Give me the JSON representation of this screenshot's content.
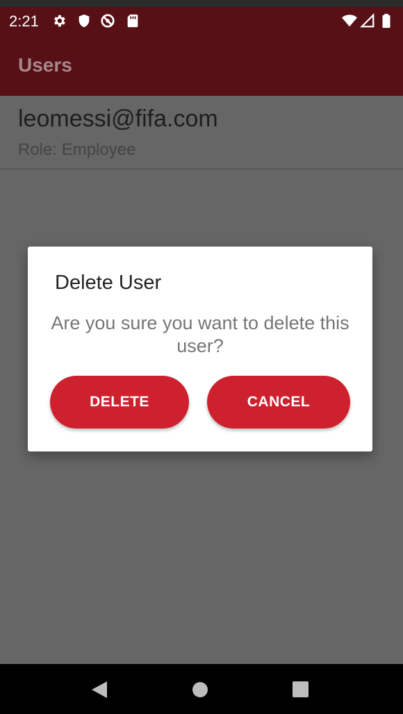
{
  "status_bar": {
    "time": "2:21",
    "left_icons": [
      "gear-icon",
      "shield-icon",
      "no-sync-icon",
      "sd-card-icon"
    ],
    "right_icons": [
      "wifi-icon",
      "cell-signal-icon",
      "battery-icon"
    ]
  },
  "app_bar": {
    "title": "Users"
  },
  "users": [
    {
      "email": "leomessi@fifa.com",
      "role": "Role: Employee"
    }
  ],
  "dialog": {
    "title": "Delete User",
    "message": "Are you sure you want to delete this user?",
    "delete_label": "DELETE",
    "cancel_label": "CANCEL"
  },
  "nav_bar": {
    "icons": [
      "back-icon",
      "home-icon",
      "recents-icon"
    ]
  },
  "colors": {
    "app_bar": "#561016",
    "scrim": "#666666",
    "button": "#cd222e",
    "dialog_bg": "#ffffff"
  }
}
